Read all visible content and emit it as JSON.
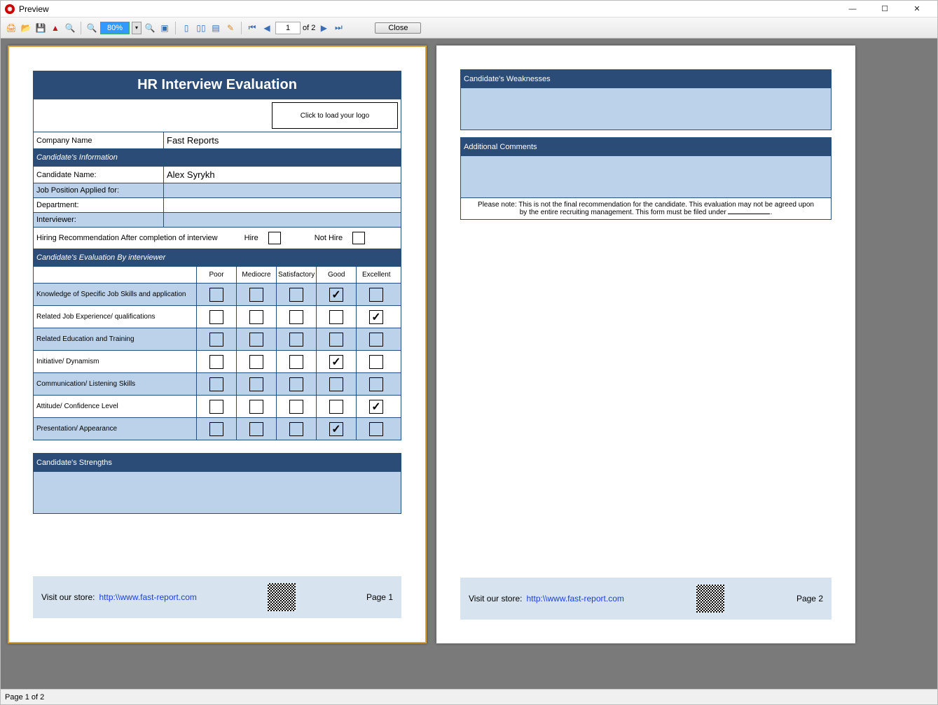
{
  "window": {
    "title": "Preview"
  },
  "toolbar": {
    "zoom": "80%",
    "page_current": "1",
    "page_of": "of 2",
    "close": "Close"
  },
  "form": {
    "title": "HR Interview Evaluation",
    "logo_hint": "Click to load your logo",
    "company_label": "Company Name",
    "company_value": "Fast Reports",
    "candidate_info_header": "Candidate's Information",
    "candidate_name_label": "Candidate Name:",
    "candidate_name_value": "Alex Syrykh",
    "job_position_label": "Job Position Applied for:",
    "department_label": "Department:",
    "interviewer_label": "Interviewer:",
    "hiring_rec_label": "Hiring Recommendation After completion of interview",
    "hire_label": "Hire",
    "not_hire_label": "Not Hire",
    "eval_header": "Candidate's Evaluation By interviewer",
    "rating_cols": [
      "Poor",
      "Mediocre",
      "Satisfactory",
      "Good",
      "Excellent"
    ],
    "criteria": [
      {
        "label": "Knowledge of Specific Job Skills and application",
        "checked": 3
      },
      {
        "label": "Related Job Experience/ qualifications",
        "checked": 4
      },
      {
        "label": "Related Education and Training",
        "checked": -1
      },
      {
        "label": "Initiative/ Dynamism",
        "checked": 3
      },
      {
        "label": "Communication/ Listening Skills",
        "checked": -1
      },
      {
        "label": "Attitude/ Confidence Level",
        "checked": 4
      },
      {
        "label": "Presentation/ Appearance",
        "checked": 3
      }
    ],
    "strengths_header": "Candidate's Strengths",
    "weaknesses_header": "Candidate's Weaknesses",
    "comments_header": "Additional Comments",
    "disclaimer": "Please note: This is not the final recommendation for the candidate. This evaluation may not be agreed upon by the entire recruiting management. This form must be filed under"
  },
  "footer": {
    "visit": "Visit our store:",
    "url": "http:\\\\www.fast-report.com",
    "page1": "Page 1",
    "page2": "Page 2"
  },
  "status": {
    "text": "Page 1 of 2"
  }
}
